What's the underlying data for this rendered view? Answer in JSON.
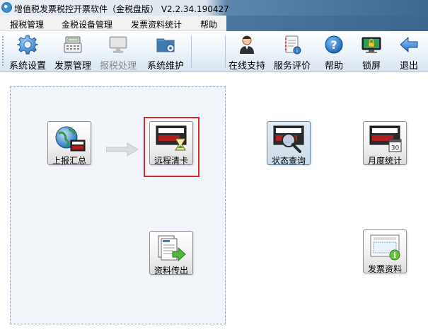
{
  "window": {
    "title": "增值税发票税控开票软件（金税盘版） V2.2.34.190427"
  },
  "menu": {
    "items": [
      "报税管理",
      "金税设备管理",
      "发票资料统计",
      "帮助"
    ]
  },
  "toolbar": {
    "left": [
      {
        "label": "系统设置",
        "icon": "gear-icon",
        "enabled": true
      },
      {
        "label": "发票管理",
        "icon": "cash-register-icon",
        "enabled": true
      },
      {
        "label": "报税处理",
        "icon": "monitor-icon",
        "enabled": false
      },
      {
        "label": "系统维护",
        "icon": "folder-settings-icon",
        "enabled": true
      }
    ],
    "right": [
      {
        "label": "在线支持",
        "icon": "support-person-icon"
      },
      {
        "label": "服务评价",
        "icon": "rating-notebook-icon"
      },
      {
        "label": "帮助",
        "icon": "help-icon"
      },
      {
        "label": "锁屏",
        "icon": "lock-screen-icon"
      },
      {
        "label": "退出",
        "icon": "exit-arrow-icon"
      }
    ]
  },
  "main": {
    "buttons": {
      "upload_summary": {
        "label": "上报汇总",
        "icon": "globe-card-icon"
      },
      "remote_clear": {
        "label": "远程清卡",
        "icon": "card-hourglass-icon"
      },
      "status_query": {
        "label": "状态查询",
        "icon": "card-magnifier-icon"
      },
      "monthly_stats": {
        "label": "月度统计",
        "icon": "card-calendar-icon",
        "calendar_day": "30"
      },
      "data_export": {
        "label": "资料传出",
        "icon": "documents-arrow-icon"
      },
      "invoice_data": {
        "label": "发票资料",
        "icon": "invoice-info-icon"
      }
    },
    "selected": "remote_clear"
  },
  "colors": {
    "selection_border": "#d52a2a",
    "panel_border": "#9aa9b8",
    "titlebar_dark": "#3d6991"
  }
}
